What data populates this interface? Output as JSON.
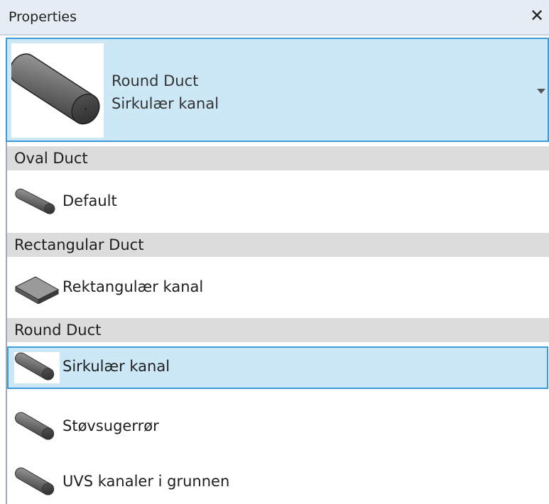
{
  "panel": {
    "title": "Properties",
    "close_glyph": "✕"
  },
  "type_selector": {
    "family": "Round Duct",
    "type": "Sirkulær kanal",
    "preview_icon": "round-duct-preview-icon",
    "dropdown_icon": "chevron-down-icon"
  },
  "groups": [
    {
      "label": "Oval Duct",
      "items": [
        {
          "label": "Default",
          "icon": "oval-duct-icon"
        }
      ]
    },
    {
      "label": "Rectangular Duct",
      "items": [
        {
          "label": "Rektangulær kanal",
          "icon": "rectangular-duct-icon"
        }
      ]
    },
    {
      "label": "Round Duct",
      "items": [
        {
          "label": "Sirkulær kanal",
          "icon": "round-duct-icon",
          "selected": true
        },
        {
          "label": "Støvsugerrør",
          "icon": "round-duct-icon"
        },
        {
          "label": "UVS kanaler i grunnen",
          "icon": "round-duct-icon"
        }
      ]
    }
  ],
  "colors": {
    "selection_fill": "#cce8f7",
    "selection_border": "#3c9ad6",
    "group_header_bg": "#dcdcdc",
    "titlebar_bg": "#e6ecf3"
  }
}
